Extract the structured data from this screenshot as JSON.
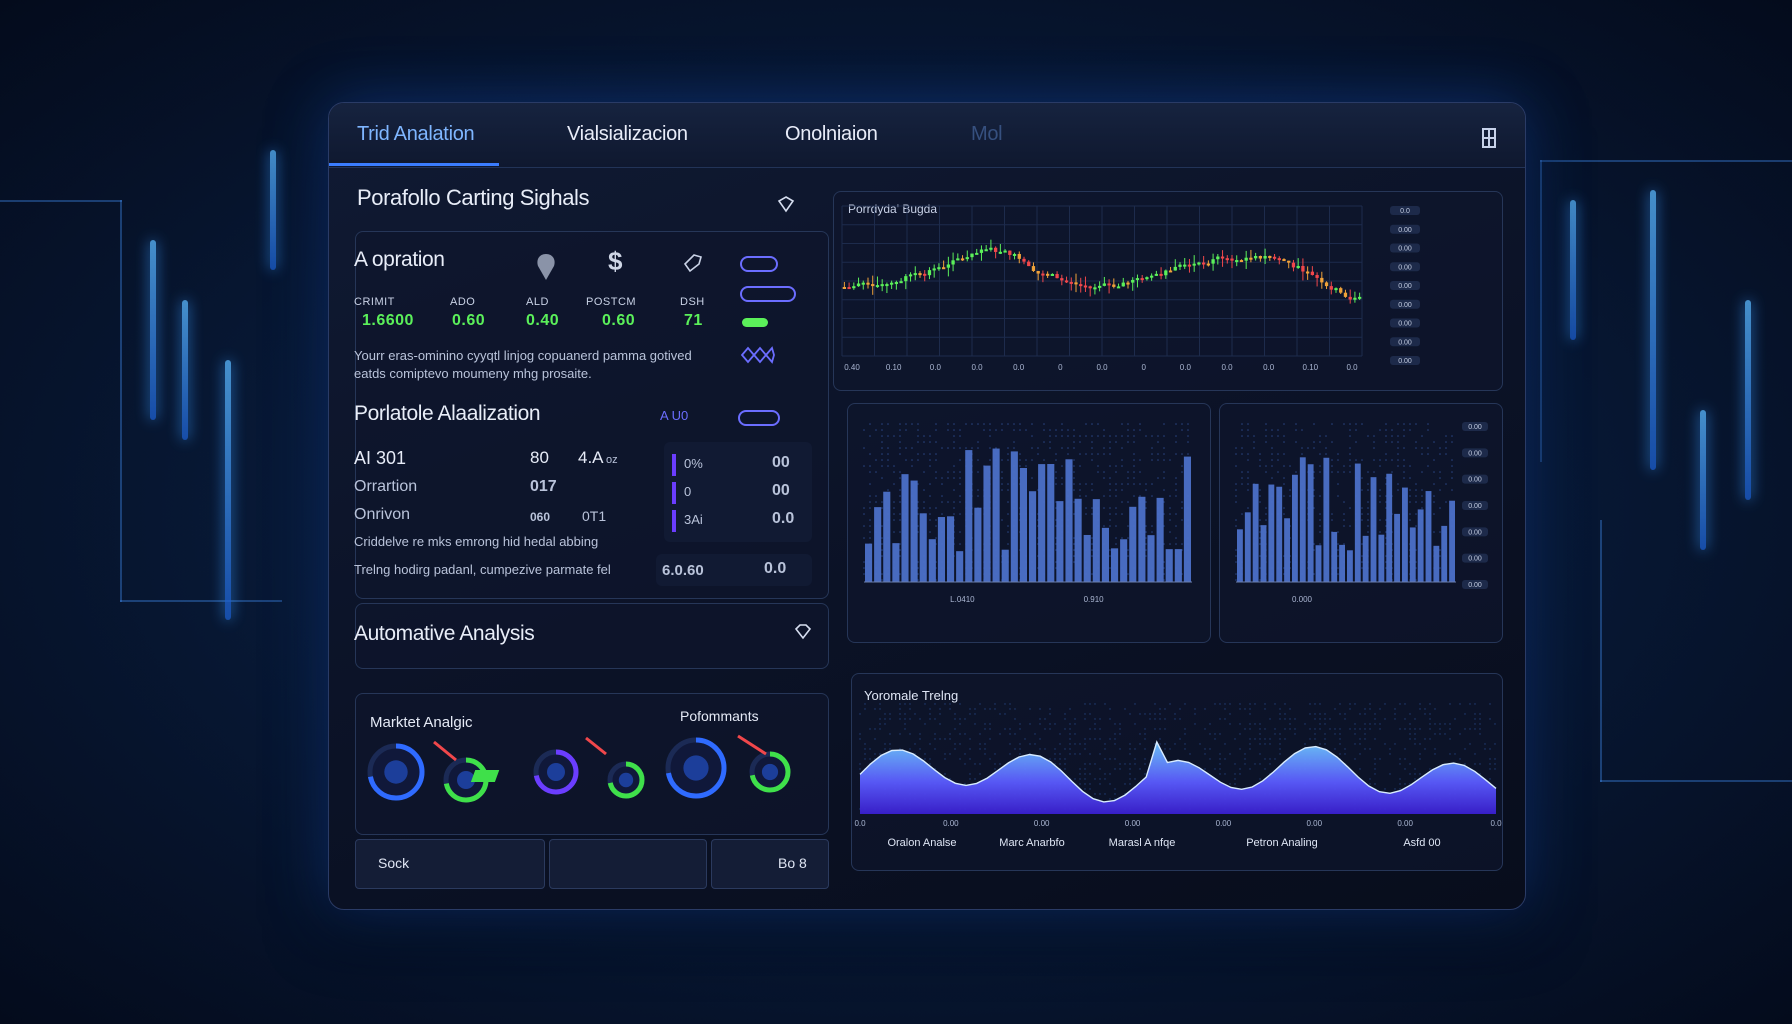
{
  "tabs": [
    {
      "label": "Trid Analation",
      "state": "active"
    },
    {
      "label": "Vialsializacion",
      "state": "normal"
    },
    {
      "label": "Onolniaion",
      "state": "normal"
    },
    {
      "label": "Mol",
      "state": "dim"
    }
  ],
  "window_icon": "building-icon",
  "left": {
    "signals_title": "Porafollo Carting Sighals",
    "operation": {
      "title": "A opration",
      "columns": [
        {
          "label": "CRIMIT",
          "value": "1.6600",
          "color": "green"
        },
        {
          "label": "ADO",
          "value": "0.60",
          "color": "green"
        },
        {
          "label": "ALD",
          "value": "0.40",
          "color": "green"
        },
        {
          "label": "POSTCM",
          "value": "0.60",
          "color": "green"
        },
        {
          "label": "DSH",
          "value": "71",
          "color": "green"
        }
      ],
      "description": [
        "Yourr eras-ominino cyyqtl linjog copuanerd pamma gotived",
        "eatds comiptevo moumeny mhg prosaite."
      ]
    },
    "analysis": {
      "title": "Porlatole Alaalization",
      "badge": "A U0",
      "rows": [
        {
          "label": "AI 301",
          "v1": "80",
          "v2": "4.A",
          "v3": "oz"
        },
        {
          "label": "Orrartion",
          "v1": "",
          "v2": "017",
          "v3": ""
        },
        {
          "label": "Onrivon",
          "v1": "060",
          "v2": "0T1",
          "v3": ""
        }
      ],
      "side_rows": [
        {
          "label": "0%",
          "value": "00"
        },
        {
          "label": "0",
          "value": "00"
        },
        {
          "label": "3Ai",
          "value": "0.0"
        }
      ],
      "note": "Criddelve re mks emrong hid hedal abbing",
      "footer_text": "Trelng hodirg padanl, cumpezive parmate fel",
      "footer_value": "6.0.60",
      "footer_side": "0.0"
    },
    "automative_title": "Automative Analysis",
    "gauges": {
      "title_left": "Marktet Analgic",
      "title_right": "Pofommants"
    },
    "buttons": [
      {
        "label": "Sock"
      },
      {
        "label": ""
      },
      {
        "label": "Bo 8"
      }
    ]
  },
  "right": {
    "candle_chart": {
      "title": "Porrdyda' Bugda",
      "x_ticks": [
        "0.40",
        "0.10",
        "0.0",
        "0.0",
        "0.0",
        "0",
        "0.0",
        "0",
        "0.0",
        "0.0",
        "0.0",
        "0.10",
        "0.0"
      ],
      "y_ticks": [
        "0.0",
        "0.00",
        "0.00",
        "0.00",
        "0.00",
        "0.00",
        "0.00",
        "0.00",
        "0.00"
      ]
    },
    "bar_chart_left": {
      "x_ticks": [
        "L.0410",
        "0.910"
      ]
    },
    "bar_chart_right": {
      "x_ticks": [
        "0.000"
      ],
      "y_ticks": [
        "0.00",
        "0.00",
        "0.00",
        "0.00",
        "0.00",
        "0.00",
        "0.00"
      ]
    },
    "area_chart": {
      "title": "Yoromale Trelng",
      "x_ticks": [
        "0.0",
        "0.00",
        "0.00",
        "0.00",
        "0.00",
        "0.00",
        "0.00",
        "0.0"
      ],
      "labels": [
        "Oralon Analse",
        "Marc Anarbfo",
        "Marasl A nfqe",
        "Petron Analing",
        "Asfd 00"
      ]
    }
  },
  "colors": {
    "accent": "#3b7dff",
    "up": "#5bf05a",
    "down": "#f0474b",
    "area": "#6a4cff"
  }
}
